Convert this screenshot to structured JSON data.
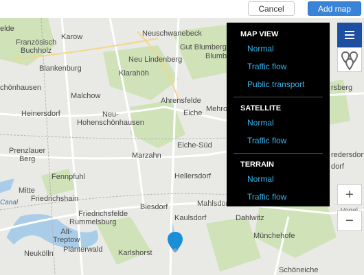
{
  "toolbar": {
    "cancel_label": "Cancel",
    "add_label": "Add map"
  },
  "map": {
    "labels": [
      "Neuschwanebeck",
      "Gut Blumberg",
      "Blumberg",
      "Französisch\nBuchholz",
      "Karow",
      "Neu Lindenberg",
      "Blankenburg",
      "Klarahöh",
      "chönhausen",
      "Malchow",
      "Ahrensfelde",
      "Heinersdorf",
      "Eiche",
      "Mehrow",
      "Neu-\nHohenschönhausen",
      "Prenzlauer\nBerg",
      "Eiche-Süd",
      "Marzahn",
      "Fennpfuhl",
      "Hellersdorf",
      "Mitte",
      "Friedrichshain",
      "Biesdorf",
      "Mahlsdorf",
      "Kaulsdorf",
      "Dahlwitz",
      "Friedrichsfelde",
      "Rummelsburg",
      "Alt-\nTreptow",
      "Plänterwald",
      "Karlshorst",
      "Neukölln",
      "Münchehofe",
      "Schöneiche",
      "elde",
      "rsberg",
      "redersdorf",
      "dorf",
      "Vogel",
      "Canal"
    ]
  },
  "layers_menu": {
    "sections": [
      {
        "title": "MAP VIEW",
        "options": [
          "Normal",
          "Traffic flow",
          "Public transport"
        ]
      },
      {
        "title": "SATELLITE",
        "options": [
          "Normal",
          "Traffic flow"
        ]
      },
      {
        "title": "TERRAIN",
        "options": [
          "Normal",
          "Traffic flow"
        ]
      }
    ]
  },
  "controls": {
    "menu_icon": "hamburger-menu-icon",
    "pins_icon": "multiple-pins-icon",
    "zoom_in_label": "+",
    "zoom_out_label": "−"
  },
  "marker": {
    "icon": "location-pin-icon",
    "color": "#1a8fd8"
  },
  "colors": {
    "menu_bg": "#000000",
    "menu_link": "#36b4ee",
    "accent": "#1c4fa0",
    "add_button": "#3a84d8"
  }
}
